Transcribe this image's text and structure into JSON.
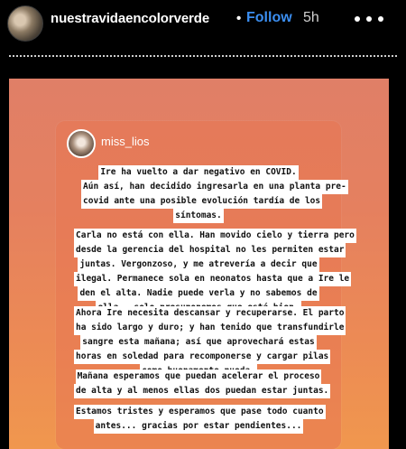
{
  "header": {
    "username": "nuestravidaencolorverde",
    "separator": "•",
    "follow_label": "Follow",
    "timestamp": "5h",
    "more_icon": "more-horizontal-icon"
  },
  "card": {
    "username": "miss_lios",
    "blocks": [
      {
        "lines": [
          "Ire ha vuelto a dar negativo en COVID.",
          "Aún así, han decidido ingresarla en una planta pre-",
          "covid ante una posible evolución tardía de los",
          "síntomas."
        ]
      },
      {
        "lines": [
          "Carla no está con ella. Han movido cielo y tierra pero",
          "desde la gerencia del hospital no les permiten estar",
          "juntas. Vergonzoso, y me atrevería a decir que",
          "ilegal. Permanece sola en neonatos hasta que a Ire le",
          "den el alta. Nadie puede verla y no sabemos de",
          "ella...solo presuponemos que está bien."
        ]
      },
      {
        "lines": [
          "Ahora Ire necesita descansar y recuperarse. El parto",
          "ha sido largo y duro; y han tenido que transfundirle",
          "sangre esta mañana; así que aprovechará estas",
          "horas en soledad para recomponerse y cargar pilas",
          "como buenamente pueda."
        ]
      },
      {
        "lines": [
          "Mañana esperamos que puedan acelerar el proceso",
          "de alta y al menos ellas dos puedan estar juntas."
        ]
      },
      {
        "lines": [
          "Estamos tristes y esperamos que pase todo cuanto",
          "antes... gracias por estar pendientes..."
        ]
      }
    ]
  }
}
